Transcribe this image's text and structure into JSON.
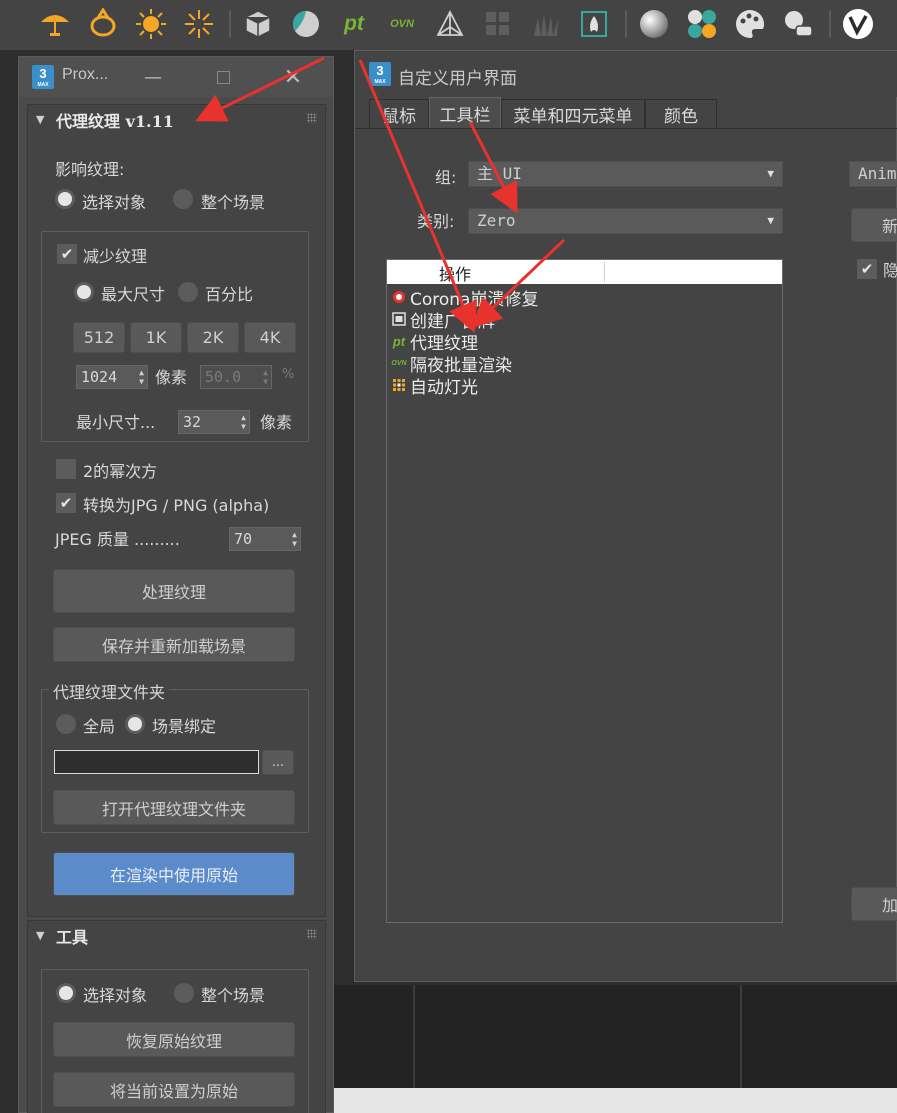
{
  "colors": {
    "accent_blue": "#5b8bc9",
    "annotation_red": "#e8322e",
    "pt_green": "#7ab535"
  },
  "toolbar": {
    "icons": [
      "umbrella-light-icon",
      "bulb-light-icon",
      "sun-icon",
      "sunburst-icon",
      "box-icon",
      "sphere-texture-icon",
      "pt-proxy-texture-icon",
      "ovn-render-icon",
      "pyramid-helper-icon",
      "grid-panel-icon",
      "grass-icon",
      "fire-icon",
      "gray-sphere-icon",
      "material-balls-icon",
      "palette-icon",
      "material-editor-icon",
      "vray-icon"
    ],
    "pt_label": "pt",
    "ovn_label": "OVN"
  },
  "proxy_window": {
    "title": "Prox...",
    "logo_num": "3",
    "logo_sub": "MAX",
    "rollout1": {
      "title": "代理纹理  v1.11",
      "affect_label": "影响纹理:",
      "radio_selected": "选择对象",
      "radio_scene": "整个场景",
      "reduce_label": "减少纹理",
      "max_size": "最大尺寸",
      "percent": "百分比",
      "size_buttons": [
        "512",
        "1K",
        "2K",
        "4K"
      ],
      "pixel_value": "1024",
      "pixel_unit": "像素",
      "percent_value": "50.0",
      "percent_unit": "%",
      "min_size_label": "最小尺寸...",
      "min_size_value": "32",
      "min_size_unit": "像素",
      "power2_label": "2的幂次方",
      "convert_label": "转换为JPG / PNG (alpha)",
      "jpeg_label": "JPEG 质量 .........",
      "jpeg_value": "70",
      "process_button": "处理纹理",
      "save_reload_button": "保存并重新加载场景",
      "folder_group_title": "代理纹理文件夹",
      "radio_global": "全局",
      "radio_scene_bind": "场景绑定",
      "path_value": "",
      "browse_button": "...",
      "open_folder_button": "打开代理纹理文件夹",
      "use_original_button": "在渲染中使用原始"
    },
    "rollout2": {
      "title": "工具",
      "radio_selected": "选择对象",
      "radio_scene": "整个场景",
      "restore_button": "恢复原始纹理",
      "set_original_button": "将当前设置为原始"
    }
  },
  "cui_window": {
    "title": "自定义用户界面",
    "logo_num": "3",
    "logo_sub": "MAX",
    "tabs": [
      "鼠标",
      "工具栏",
      "菜单和四元菜单",
      "颜色"
    ],
    "active_tab": "工具栏",
    "group_label": "组:",
    "group_value": "主 UI",
    "category_label": "类别:",
    "category_value": "Zero",
    "right_combo_value": "Anima",
    "right_new_button": "新",
    "right_hide_label": "隐",
    "right_add_button": "加",
    "list_header": "操作",
    "list_items": [
      {
        "label": "Corona崩溃修复",
        "icon": "corona-icon"
      },
      {
        "label": "创建广告牌",
        "icon": "billboard-icon"
      },
      {
        "label": "代理纹理",
        "icon": "pt-icon"
      },
      {
        "label": "隔夜批量渲染",
        "icon": "ovn-icon"
      },
      {
        "label": "自动灯光",
        "icon": "auto-light-icon"
      }
    ]
  }
}
